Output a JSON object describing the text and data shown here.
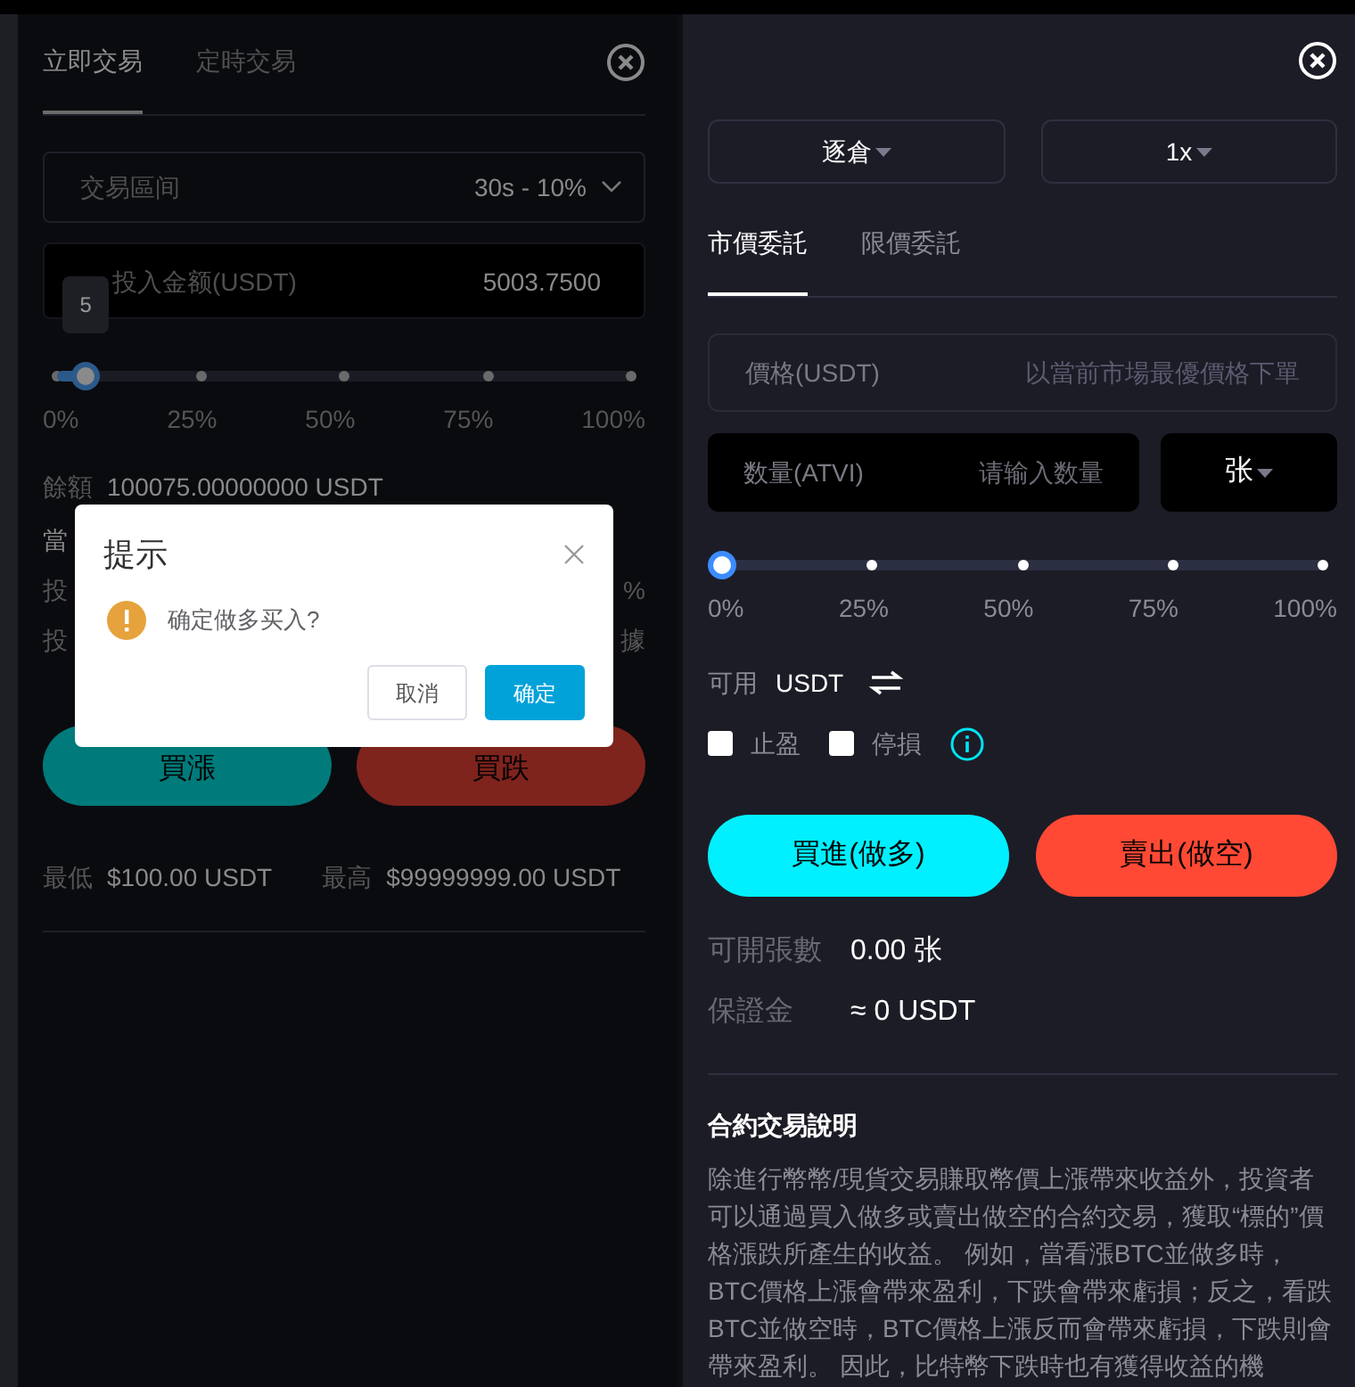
{
  "left_panel": {
    "tabs": [
      {
        "label": "立即交易",
        "selected": true
      },
      {
        "label": "定時交易",
        "selected": false
      }
    ],
    "interval": {
      "label": "交易區间",
      "value": "30s - 10%"
    },
    "amount": {
      "label": "投入金额(USDT)",
      "value": "5003.7500"
    },
    "slider": {
      "level": 0.05,
      "tooltip": "5",
      "ticks": [
        "0%",
        "25%",
        "50%",
        "75%",
        "100%"
      ]
    },
    "balance": {
      "label": "餘額",
      "value": "100075.00000000 USDT"
    },
    "hidden_rows": [
      {
        "label": "當"
      },
      {
        "label": "投",
        "value": "%"
      },
      {
        "label": "投",
        "value": "據"
      }
    ],
    "buttons": [
      {
        "label": "買漲",
        "kind": "up"
      },
      {
        "label": "買跌",
        "kind": "down"
      }
    ],
    "limits": [
      {
        "label": "最低",
        "value": "$100.00 USDT"
      },
      {
        "label": "最高",
        "value": "$99999999.00 USDT"
      }
    ]
  },
  "dialog": {
    "title": "提示",
    "message": "确定做多买入?",
    "buttons": [
      {
        "label": "取消",
        "kind": "secondary"
      },
      {
        "label": "确定",
        "kind": "primary"
      }
    ]
  },
  "right_panel": {
    "dropdowns": [
      "逐倉",
      "1x"
    ],
    "tabs": [
      {
        "label": "市價委託",
        "selected": true
      },
      {
        "label": "限價委託",
        "selected": false
      }
    ],
    "price": {
      "label": "價格(USDT)",
      "placeholder": "以當前市場最優價格下單"
    },
    "quantity": {
      "label": "数量(ATVI)",
      "placeholder": "请输入数量",
      "unit": "张"
    },
    "slider": {
      "level": 0,
      "ticks": [
        "0%",
        "25%",
        "50%",
        "75%",
        "100%"
      ]
    },
    "available": {
      "label": "可用",
      "value": "USDT"
    },
    "options": [
      {
        "label": "止盈",
        "checked": false
      },
      {
        "label": "停損",
        "checked": false
      }
    ],
    "buttons": [
      {
        "label": "買進(做多)",
        "kind": "long"
      },
      {
        "label": "賣出(做空)",
        "kind": "short"
      }
    ],
    "stats": [
      {
        "label": "可開張數",
        "value": "0.00 张"
      },
      {
        "label": "保證金",
        "value": "≈ 0 USDT"
      }
    ],
    "info_title": "合約交易說明",
    "info_text": "除進行幣幣/現貨交易賺取幣價上漲帶來收益外，投資者可以通過買入做多或賣出做空的合約交易，獲取“標的”價格漲跌所產生的收益。 例如，當看漲BTC並做多時，BTC價格上漲會帶來盈利，下跌會帶來虧損；反之，看跌BTC並做空時，BTC價格上漲反而會帶來虧損，下跌則會帶來盈利。 因此，比特幣下跌時也有獲得收益的機"
  }
}
